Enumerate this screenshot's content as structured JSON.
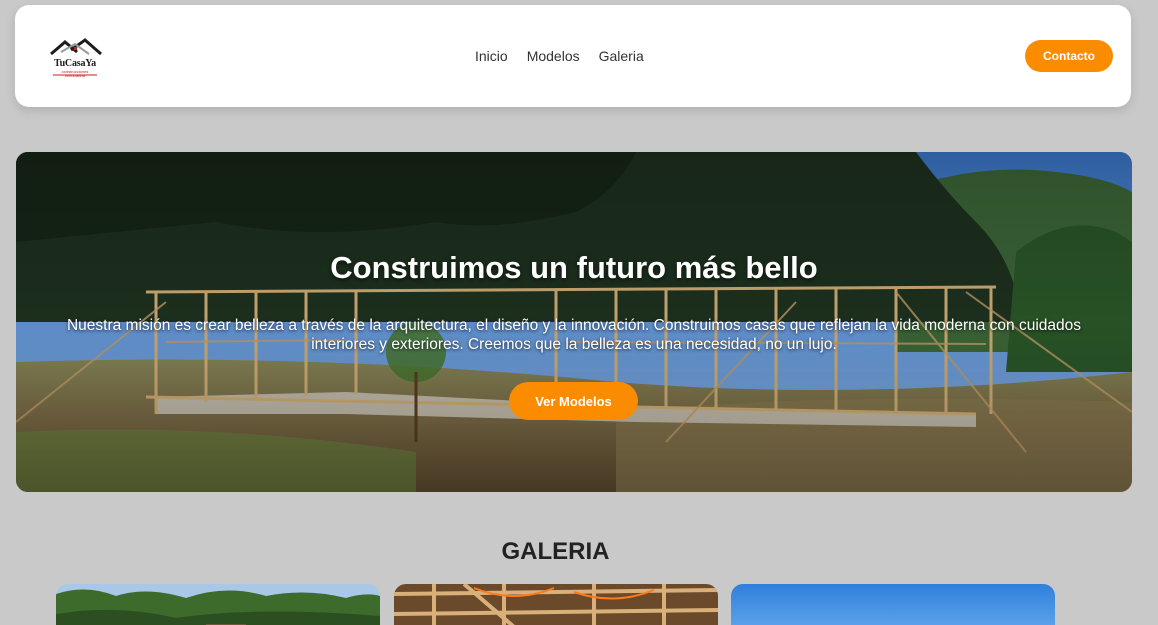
{
  "brand": {
    "name": "TuCasaYa",
    "tagline": "construcciones inmobiliaria"
  },
  "nav": {
    "links": [
      "Inicio",
      "Modelos",
      "Galeria"
    ],
    "contact_label": "Contacto"
  },
  "hero": {
    "title": "Construimos un futuro más bello",
    "text": "Nuestra misión es crear belleza a través de la arquitectura, el diseño y la innovación. Construimos casas que reflejan la vida moderna con cuidados interiores y exteriores. Creemos que la belleza es una necesidad, no un lujo.",
    "button_label": "Ver Modelos",
    "image": "house-frame-construction-photo"
  },
  "gallery": {
    "title": "GALERIA",
    "cards": [
      {
        "image": "trees-sky-photo"
      },
      {
        "image": "wooden-frame-photo"
      },
      {
        "image": "blue-sky-photo"
      }
    ]
  },
  "colors": {
    "background": "#c9c9c9",
    "accent": "#fb8c00",
    "navbar": "#ffffff",
    "text_dark": "#222222"
  }
}
